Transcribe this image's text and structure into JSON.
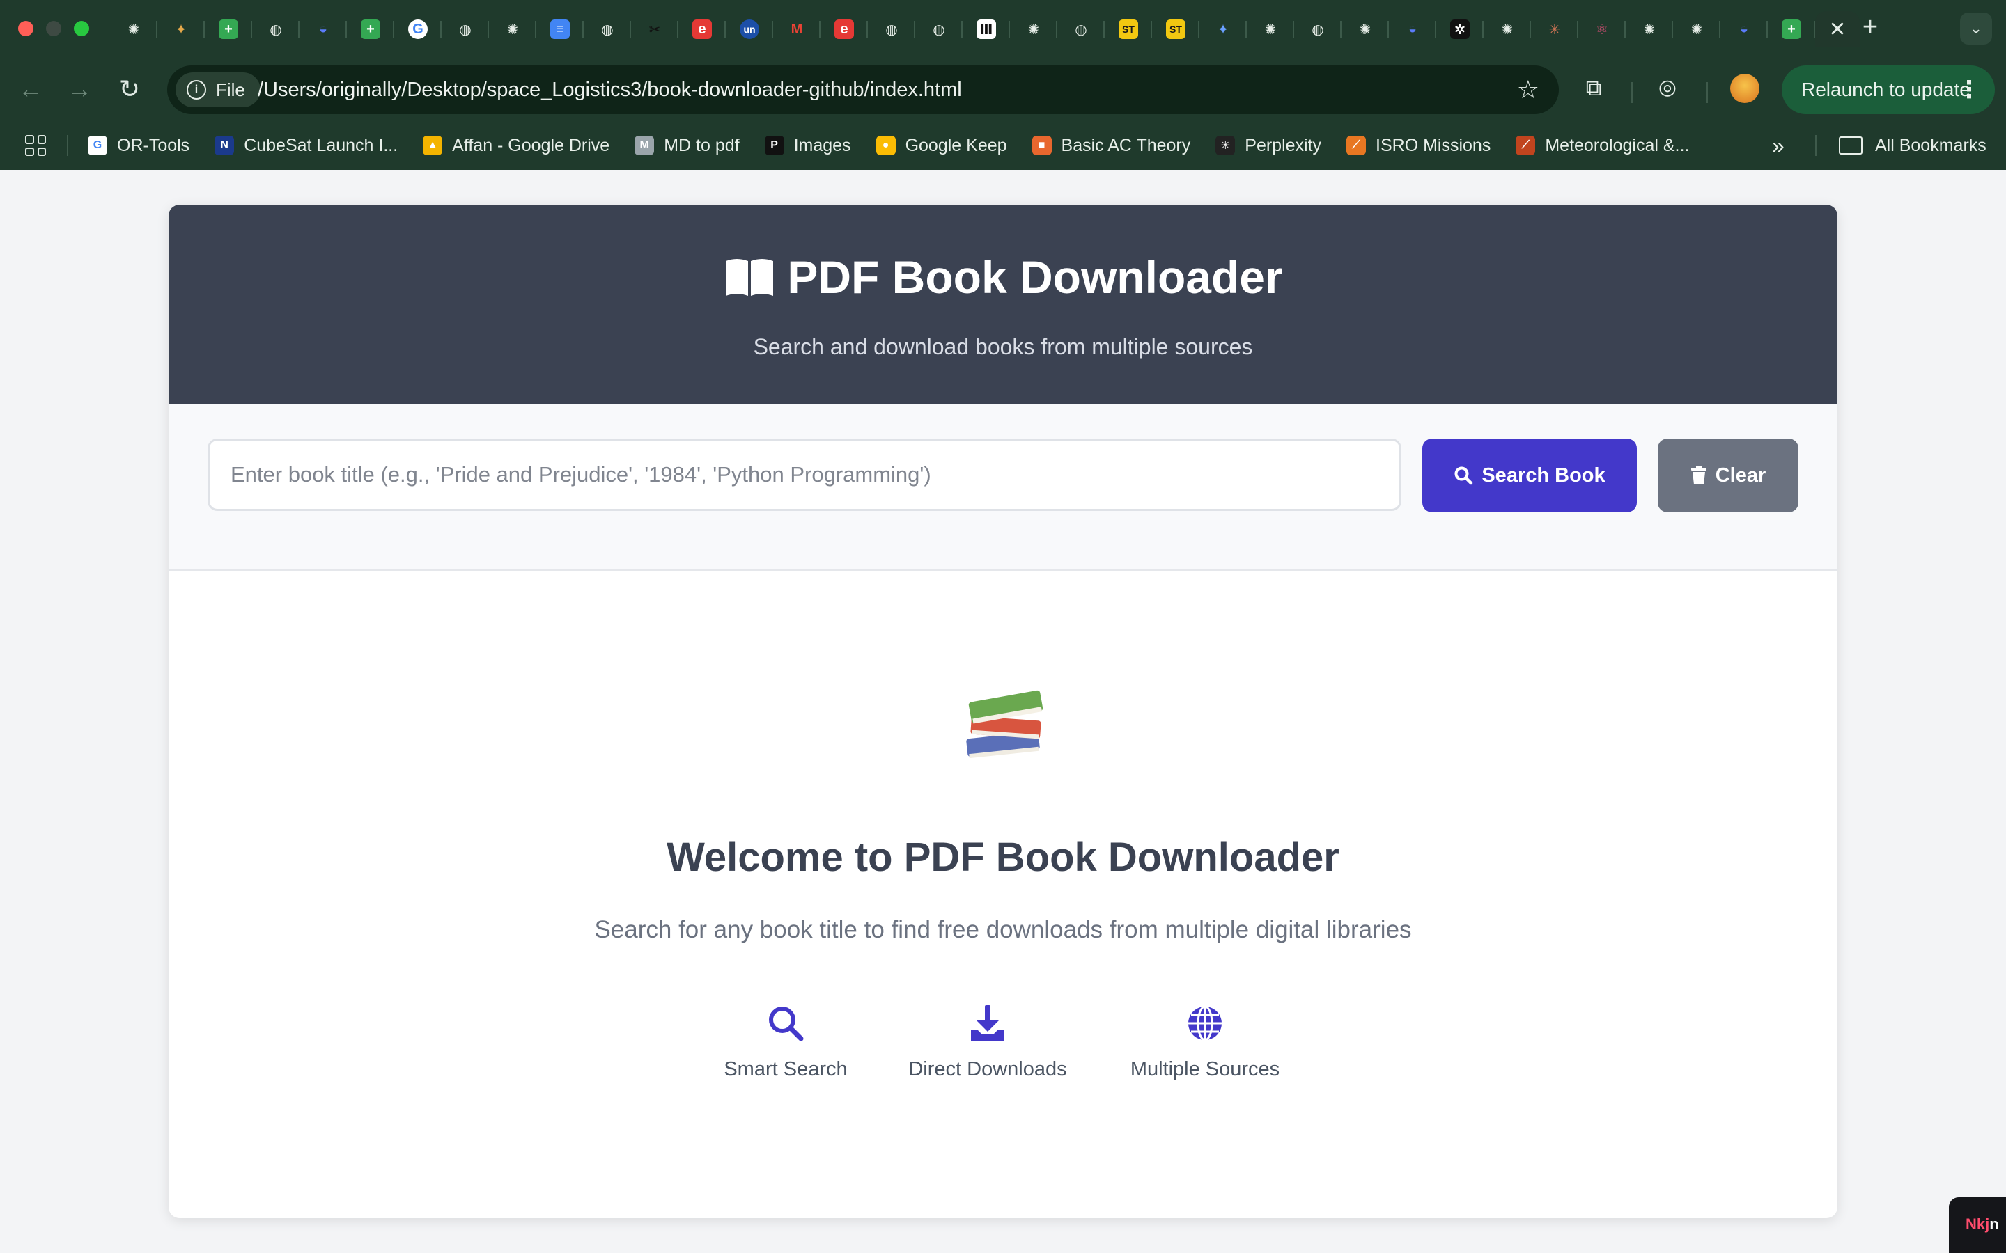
{
  "browser": {
    "active_tab_close": "✕",
    "new_tab": "+",
    "address": {
      "chip_label": "File",
      "url": "/Users/originally/Desktop/space_Logistics3/book-downloader-github/index.html"
    },
    "relaunch_label": "Relaunch to update",
    "bookmarks": [
      {
        "label": "OR-Tools",
        "icon": "google-icon",
        "color": "#ffffff"
      },
      {
        "label": "CubeSat Launch I...",
        "icon": "nasa-icon",
        "color": "#1b3a8c"
      },
      {
        "label": "Affan - Google Drive",
        "icon": "google-drive-icon",
        "color": "#f4b400"
      },
      {
        "label": "MD to pdf",
        "icon": "md-icon",
        "color": "#9aa5ab"
      },
      {
        "label": "Images",
        "icon": "images-icon",
        "color": "#111111"
      },
      {
        "label": "Google Keep",
        "icon": "keep-icon",
        "color": "#fbbc04"
      },
      {
        "label": "Basic AC Theory",
        "icon": "ac-icon",
        "color": "#e8672e"
      },
      {
        "label": "Perplexity",
        "icon": "perplexity-icon",
        "color": "#222222"
      },
      {
        "label": "ISRO Missions",
        "icon": "isro-icon",
        "color": "#e87722"
      },
      {
        "label": "Meteorological &...",
        "icon": "meteo-icon",
        "color": "#c1441e"
      }
    ],
    "bookmarks_more": "»",
    "all_bookmarks": "All Bookmarks"
  },
  "page": {
    "hero": {
      "title": "PDF Book Downloader",
      "subtitle": "Search and download books from multiple sources"
    },
    "search": {
      "placeholder": "Enter book title (e.g., 'Pride and Prejudice', '1984', 'Python Programming')",
      "value": "",
      "search_button": "Search Book",
      "clear_button": "Clear"
    },
    "welcome": {
      "title": "Welcome to PDF Book Downloader",
      "subtitle": "Search for any book title to find free downloads from multiple digital libraries"
    },
    "features": [
      {
        "label": "Smart Search",
        "icon": "magnifier-icon"
      },
      {
        "label": "Direct Downloads",
        "icon": "download-icon"
      },
      {
        "label": "Multiple Sources",
        "icon": "globe-icon"
      }
    ]
  },
  "corner_widget": {
    "text_red": "Nkj",
    "text_white": "n"
  },
  "colors": {
    "hero_bg": "#3b4252",
    "primary": "#4338ca",
    "secondary": "#6b7280",
    "chrome_bg": "#1f3a2c"
  }
}
